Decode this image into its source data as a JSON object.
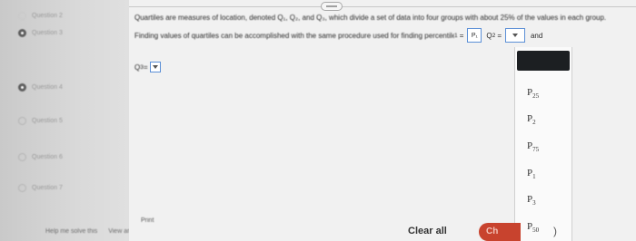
{
  "sidebar": {
    "items": [
      {
        "label": "Question 2"
      },
      {
        "label": "Question 3"
      },
      {
        "label": "Question 4"
      },
      {
        "label": "Question 5"
      },
      {
        "label": "Question 6"
      },
      {
        "label": "Question 7"
      }
    ],
    "footer": [
      "Help me solve this",
      "View an example"
    ]
  },
  "question": {
    "line1": "Quartiles are measures of location, denoted Q₁, Q₂, and Q₃, which divide a set of data into four groups with about 25% of the values in each group.",
    "line2_prefix": "Finding values of quartiles can be accomplished with the same procedure used for finding percentiles, by using Q",
    "q1_sub": "1",
    "eq1": "=",
    "q1_answer": "P₁",
    "q2_label": "Q",
    "q2_sub": "2",
    "eq2": "=",
    "q2_answer": "",
    "and_text": "and",
    "q3_label": "Q",
    "q3_sub": "3",
    "eq3": "=",
    "q3_answer": ""
  },
  "dropdown": {
    "options": [
      {
        "base": "P",
        "sub": "25"
      },
      {
        "base": "P",
        "sub": "2"
      },
      {
        "base": "P",
        "sub": "75"
      },
      {
        "base": "P",
        "sub": "1"
      },
      {
        "base": "P",
        "sub": "3"
      },
      {
        "base": "P",
        "sub": "50"
      }
    ]
  },
  "footer": {
    "print": "Print",
    "clear_all": "Clear all",
    "check": "Ch",
    "right_mark": ")"
  }
}
